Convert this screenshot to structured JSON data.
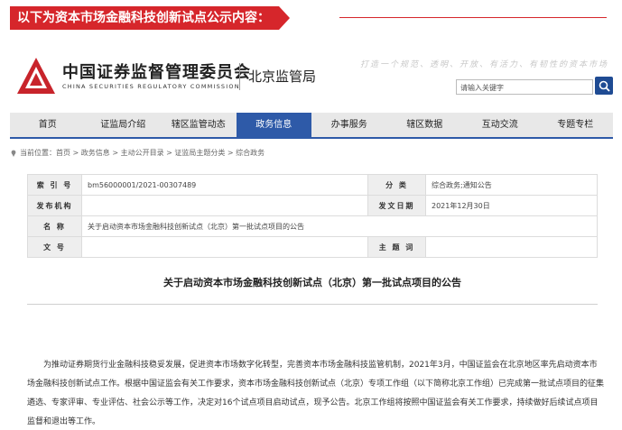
{
  "ribbon": {
    "text": "以下为资本市场金融科技创新试点公示内容："
  },
  "header": {
    "org_cn": "中国证券监督管理委员会",
    "org_en": "CHINA SECURITIES REGULATORY COMMISSION",
    "bureau": "北京监管局",
    "slogan": "打造一个规范、透明、开放、有活力、有韧性的资本市场",
    "search_placeholder": "请输入关键字"
  },
  "nav": {
    "items": [
      {
        "label": "首页"
      },
      {
        "label": "证监局介绍"
      },
      {
        "label": "辖区监管动态"
      },
      {
        "label": "政务信息",
        "active": true
      },
      {
        "label": "办事服务"
      },
      {
        "label": "辖区数据"
      },
      {
        "label": "互动交流"
      },
      {
        "label": "专题专栏"
      }
    ]
  },
  "breadcrumb": "当前位置：首页 > 政务信息 > 主动公开目录 > 证监局主题分类 > 综合政务",
  "meta": {
    "index_label": "索 引 号",
    "index_value": "bm56000001/2021-00307489",
    "category_label": "分 类",
    "category_value": "综合政务;通知公告",
    "issuer_label": "发布机构",
    "issuer_value": "",
    "date_label": "发文日期",
    "date_value": "2021年12月30日",
    "name_label": "名 称",
    "name_value": "关于启动资本市场金融科技创新试点（北京）第一批试点项目的公告",
    "docno_label": "文 号",
    "docno_value": "",
    "subject_label": "主 题 词",
    "subject_value": ""
  },
  "document": {
    "title": "关于启动资本市场金融科技创新试点（北京）第一批试点项目的公告",
    "body": "为推动证券期货行业金融科技稳妥发展，促进资本市场数字化转型，完善资本市场金融科技监管机制，2021年3月，中国证监会在北京地区率先启动资本市场金融科技创新试点工作。根据中国证监会有关工作要求，资本市场金融科技创新试点（北京）专项工作组（以下简称北京工作组）已完成第一批试点项目的征集遴选、专家评审、专业评估、社会公示等工作，决定对16个试点项目启动试点，现予公告。北京工作组将按照中国证监会有关工作要求，持续做好后续试点项目监督和退出等工作。"
  },
  "colors": {
    "accent_red": "#d6262b",
    "nav_blue": "#2e5aa8",
    "search_blue": "#1f4b93"
  }
}
